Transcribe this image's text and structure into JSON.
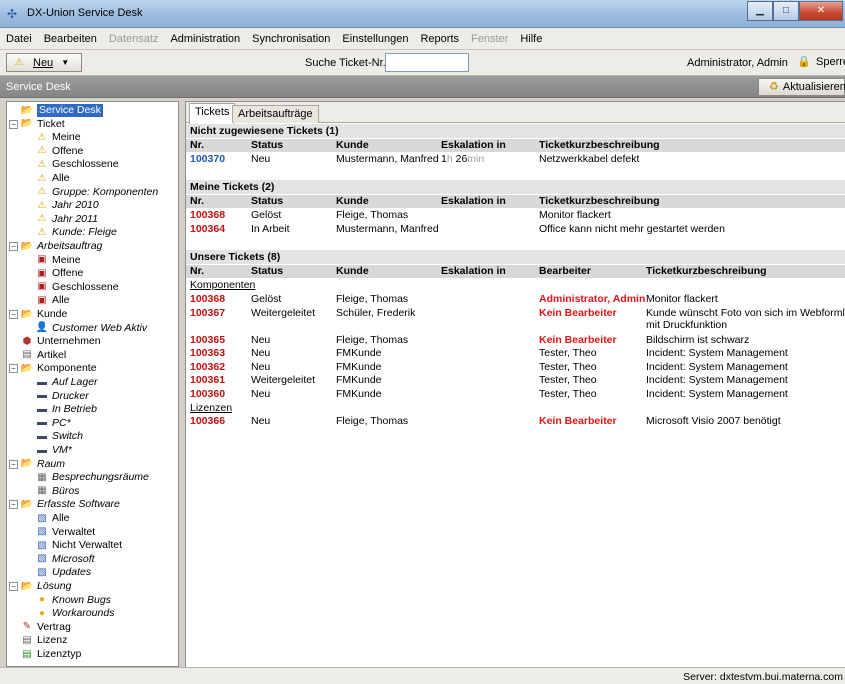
{
  "window": {
    "title": "DX-Union Service Desk",
    "minimize": "▁",
    "maximize": "□",
    "close": "✕"
  },
  "menu": [
    {
      "label": "Datei",
      "enabled": true
    },
    {
      "label": "Bearbeiten",
      "enabled": true
    },
    {
      "label": "Datensatz",
      "enabled": false
    },
    {
      "label": "Administration",
      "enabled": true
    },
    {
      "label": "Synchronisation",
      "enabled": true
    },
    {
      "label": "Einstellungen",
      "enabled": true
    },
    {
      "label": "Reports",
      "enabled": true
    },
    {
      "label": "Fenster",
      "enabled": false
    },
    {
      "label": "Hilfe",
      "enabled": true
    }
  ],
  "toolbar": {
    "new_label": "Neu",
    "search_label": "Suche Ticket-Nr.",
    "search_value": "",
    "user": "Administrator, Admin",
    "lock_label": "Sperren"
  },
  "servicedesk": {
    "title": "Service Desk",
    "refresh_label": "Aktualisieren"
  },
  "tree": [
    {
      "label": "Service Desk",
      "level": 0,
      "icon": "folder-open-icon",
      "toggle": "",
      "selected": true,
      "italic": false
    },
    {
      "label": "Ticket",
      "level": 0,
      "icon": "folder-open-icon",
      "toggle": "−",
      "selected": false,
      "italic": false
    },
    {
      "label": "Meine",
      "level": 1,
      "icon": "warning-icon",
      "toggle": "",
      "selected": false,
      "italic": false
    },
    {
      "label": "Offene",
      "level": 1,
      "icon": "warning-icon",
      "toggle": "",
      "selected": false,
      "italic": false
    },
    {
      "label": "Geschlossene",
      "level": 1,
      "icon": "warning-icon",
      "toggle": "",
      "selected": false,
      "italic": false
    },
    {
      "label": "Alle",
      "level": 1,
      "icon": "warning-icon",
      "toggle": "",
      "selected": false,
      "italic": false
    },
    {
      "label": "Gruppe: Komponenten",
      "level": 1,
      "icon": "warning-icon",
      "toggle": "",
      "selected": false,
      "italic": true
    },
    {
      "label": "Jahr 2010",
      "level": 1,
      "icon": "warning-icon",
      "toggle": "",
      "selected": false,
      "italic": true
    },
    {
      "label": "Jahr 2011",
      "level": 1,
      "icon": "warning-icon",
      "toggle": "",
      "selected": false,
      "italic": true
    },
    {
      "label": "Kunde: Fleige",
      "level": 1,
      "icon": "warning-icon",
      "toggle": "",
      "selected": false,
      "italic": true
    },
    {
      "label": "Arbeitsauftrag",
      "level": 0,
      "icon": "folder-open-icon",
      "toggle": "−",
      "selected": false,
      "italic": true
    },
    {
      "label": "Meine",
      "level": 1,
      "icon": "work-order-icon",
      "toggle": "",
      "selected": false,
      "italic": false
    },
    {
      "label": "Offene",
      "level": 1,
      "icon": "work-order-icon",
      "toggle": "",
      "selected": false,
      "italic": false
    },
    {
      "label": "Geschlossene",
      "level": 1,
      "icon": "work-order-icon",
      "toggle": "",
      "selected": false,
      "italic": false
    },
    {
      "label": "Alle",
      "level": 1,
      "icon": "work-order-icon",
      "toggle": "",
      "selected": false,
      "italic": false
    },
    {
      "label": "Kunde",
      "level": 0,
      "icon": "folder-open-icon",
      "toggle": "−",
      "selected": false,
      "italic": false
    },
    {
      "label": "Customer Web Aktiv",
      "level": 1,
      "icon": "customer-icon",
      "toggle": "",
      "selected": false,
      "italic": true
    },
    {
      "label": "Unternehmen",
      "level": 0,
      "icon": "company-icon",
      "toggle": "",
      "selected": false,
      "italic": false
    },
    {
      "label": "Artikel",
      "level": 0,
      "icon": "article-icon",
      "toggle": "",
      "selected": false,
      "italic": false
    },
    {
      "label": "Komponente",
      "level": 0,
      "icon": "folder-open-icon",
      "toggle": "−",
      "selected": false,
      "italic": false
    },
    {
      "label": "Auf Lager",
      "level": 1,
      "icon": "component-icon",
      "toggle": "",
      "selected": false,
      "italic": true
    },
    {
      "label": "Drucker",
      "level": 1,
      "icon": "component-icon",
      "toggle": "",
      "selected": false,
      "italic": true
    },
    {
      "label": "In Betrieb",
      "level": 1,
      "icon": "component-icon",
      "toggle": "",
      "selected": false,
      "italic": true
    },
    {
      "label": "PC*",
      "level": 1,
      "icon": "component-icon",
      "toggle": "",
      "selected": false,
      "italic": true
    },
    {
      "label": "Switch",
      "level": 1,
      "icon": "component-icon",
      "toggle": "",
      "selected": false,
      "italic": true
    },
    {
      "label": "VM*",
      "level": 1,
      "icon": "component-icon",
      "toggle": "",
      "selected": false,
      "italic": true
    },
    {
      "label": "Raum",
      "level": 0,
      "icon": "folder-open-icon",
      "toggle": "−",
      "selected": false,
      "italic": true
    },
    {
      "label": "Besprechungsräume",
      "level": 1,
      "icon": "room-icon",
      "toggle": "",
      "selected": false,
      "italic": true
    },
    {
      "label": "Büros",
      "level": 1,
      "icon": "room-icon",
      "toggle": "",
      "selected": false,
      "italic": true
    },
    {
      "label": "Erfasste Software",
      "level": 0,
      "icon": "folder-open-icon",
      "toggle": "−",
      "selected": false,
      "italic": true
    },
    {
      "label": "Alle",
      "level": 1,
      "icon": "software-icon",
      "toggle": "",
      "selected": false,
      "italic": false
    },
    {
      "label": "Verwaltet",
      "level": 1,
      "icon": "software-icon",
      "toggle": "",
      "selected": false,
      "italic": false
    },
    {
      "label": "Nicht Verwaltet",
      "level": 1,
      "icon": "software-icon",
      "toggle": "",
      "selected": false,
      "italic": false
    },
    {
      "label": "Microsoft",
      "level": 1,
      "icon": "software-icon",
      "toggle": "",
      "selected": false,
      "italic": true
    },
    {
      "label": "Updates",
      "level": 1,
      "icon": "software-icon",
      "toggle": "",
      "selected": false,
      "italic": true
    },
    {
      "label": "Lösung",
      "level": 0,
      "icon": "folder-open-icon",
      "toggle": "−",
      "selected": false,
      "italic": true
    },
    {
      "label": "Known Bugs",
      "level": 1,
      "icon": "lightbulb-icon",
      "toggle": "",
      "selected": false,
      "italic": true
    },
    {
      "label": "Workarounds",
      "level": 1,
      "icon": "lightbulb-icon",
      "toggle": "",
      "selected": false,
      "italic": true
    },
    {
      "label": "Vertrag",
      "level": 0,
      "icon": "contract-icon",
      "toggle": "",
      "selected": false,
      "italic": false
    },
    {
      "label": "Lizenz",
      "level": 0,
      "icon": "license-icon",
      "toggle": "",
      "selected": false,
      "italic": false
    },
    {
      "label": "Lizenztyp",
      "level": 0,
      "icon": "license-type-icon",
      "toggle": "",
      "selected": false,
      "italic": false
    }
  ],
  "tabs": [
    {
      "label": "Tickets",
      "active": true
    },
    {
      "label": "Arbeitsaufträge",
      "active": false
    }
  ],
  "sections": {
    "unassigned": {
      "title": "Nicht zugewiesene Tickets (1)",
      "columns": [
        "Nr.",
        "Status",
        "Kunde",
        "Eskalation in",
        "Ticketkurzbeschreibung"
      ],
      "rows": [
        {
          "nr": "100370",
          "status": "Neu",
          "kunde": "Mustermann, Manfred",
          "esc_h": "1",
          "esc_h_unit": "h",
          "esc_m": "26",
          "esc_m_unit": "min",
          "desc": "Netzwerkkabel defekt"
        }
      ]
    },
    "mine": {
      "title": "Meine Tickets (2)",
      "columns": [
        "Nr.",
        "Status",
        "Kunde",
        "Eskalation in",
        "Ticketkurzbeschreibung"
      ],
      "rows": [
        {
          "nr": "100368",
          "status": "Gelöst",
          "kunde": "Fleige, Thomas",
          "desc": "Monitor flackert"
        },
        {
          "nr": "100364",
          "status": "In Arbeit",
          "kunde": "Mustermann, Manfred",
          "desc": "Office kann nicht mehr gestartet werden"
        }
      ]
    },
    "ours": {
      "title": "Unsere Tickets (8)",
      "columns": [
        "Nr.",
        "Status",
        "Kunde",
        "Eskalation in",
        "Bearbeiter",
        "Ticketkurzbeschreibung"
      ],
      "group_komponenten": "Komponenten",
      "group_lizenzen": "Lizenzen",
      "rows_komponenten": [
        {
          "nr": "100368",
          "status": "Gelöst",
          "kunde": "Fleige, Thomas",
          "bearbeiter": "Administrator, Admin",
          "bearb_red": true,
          "desc": "Monitor flackert"
        },
        {
          "nr": "100367",
          "status": "Weitergeleitet",
          "kunde": "Schüler, Frederik",
          "bearbeiter": "Kein Bearbeiter",
          "bearb_red": true,
          "desc": "Kunde wünscht Foto von sich im Webformluar",
          "desc2": "mit Druckfunktion"
        },
        {
          "nr": "100365",
          "status": "Neu",
          "kunde": "Fleige, Thomas",
          "bearbeiter": "Kein Bearbeiter",
          "bearb_red": true,
          "desc": "Bildschirm ist schwarz"
        },
        {
          "nr": "100363",
          "status": "Neu",
          "kunde": "FMKunde",
          "bearbeiter": "Tester, Theo",
          "bearb_red": false,
          "desc": "Incident: System Management"
        },
        {
          "nr": "100362",
          "status": "Neu",
          "kunde": "FMKunde",
          "bearbeiter": "Tester, Theo",
          "bearb_red": false,
          "desc": "Incident: System Management"
        },
        {
          "nr": "100361",
          "status": "Weitergeleitet",
          "kunde": "FMKunde",
          "bearbeiter": "Tester, Theo",
          "bearb_red": false,
          "desc": "Incident: System Management"
        },
        {
          "nr": "100360",
          "status": "Neu",
          "kunde": "FMKunde",
          "bearbeiter": "Tester, Theo",
          "bearb_red": false,
          "desc": "Incident: System Management"
        }
      ],
      "rows_lizenzen": [
        {
          "nr": "100366",
          "status": "Neu",
          "kunde": "Fleige, Thomas",
          "bearbeiter": "Kein Bearbeiter",
          "bearb_red": true,
          "desc": "Microsoft Visio 2007 benötigt"
        }
      ]
    }
  },
  "statusbar": {
    "server": "Server: dxtestvm.bui.materna.com"
  },
  "colors": {
    "selection": "#316ac5",
    "ticket_red": "#c01010",
    "ticket_blue": "#1f57b5",
    "alert_red": "#e11515"
  }
}
